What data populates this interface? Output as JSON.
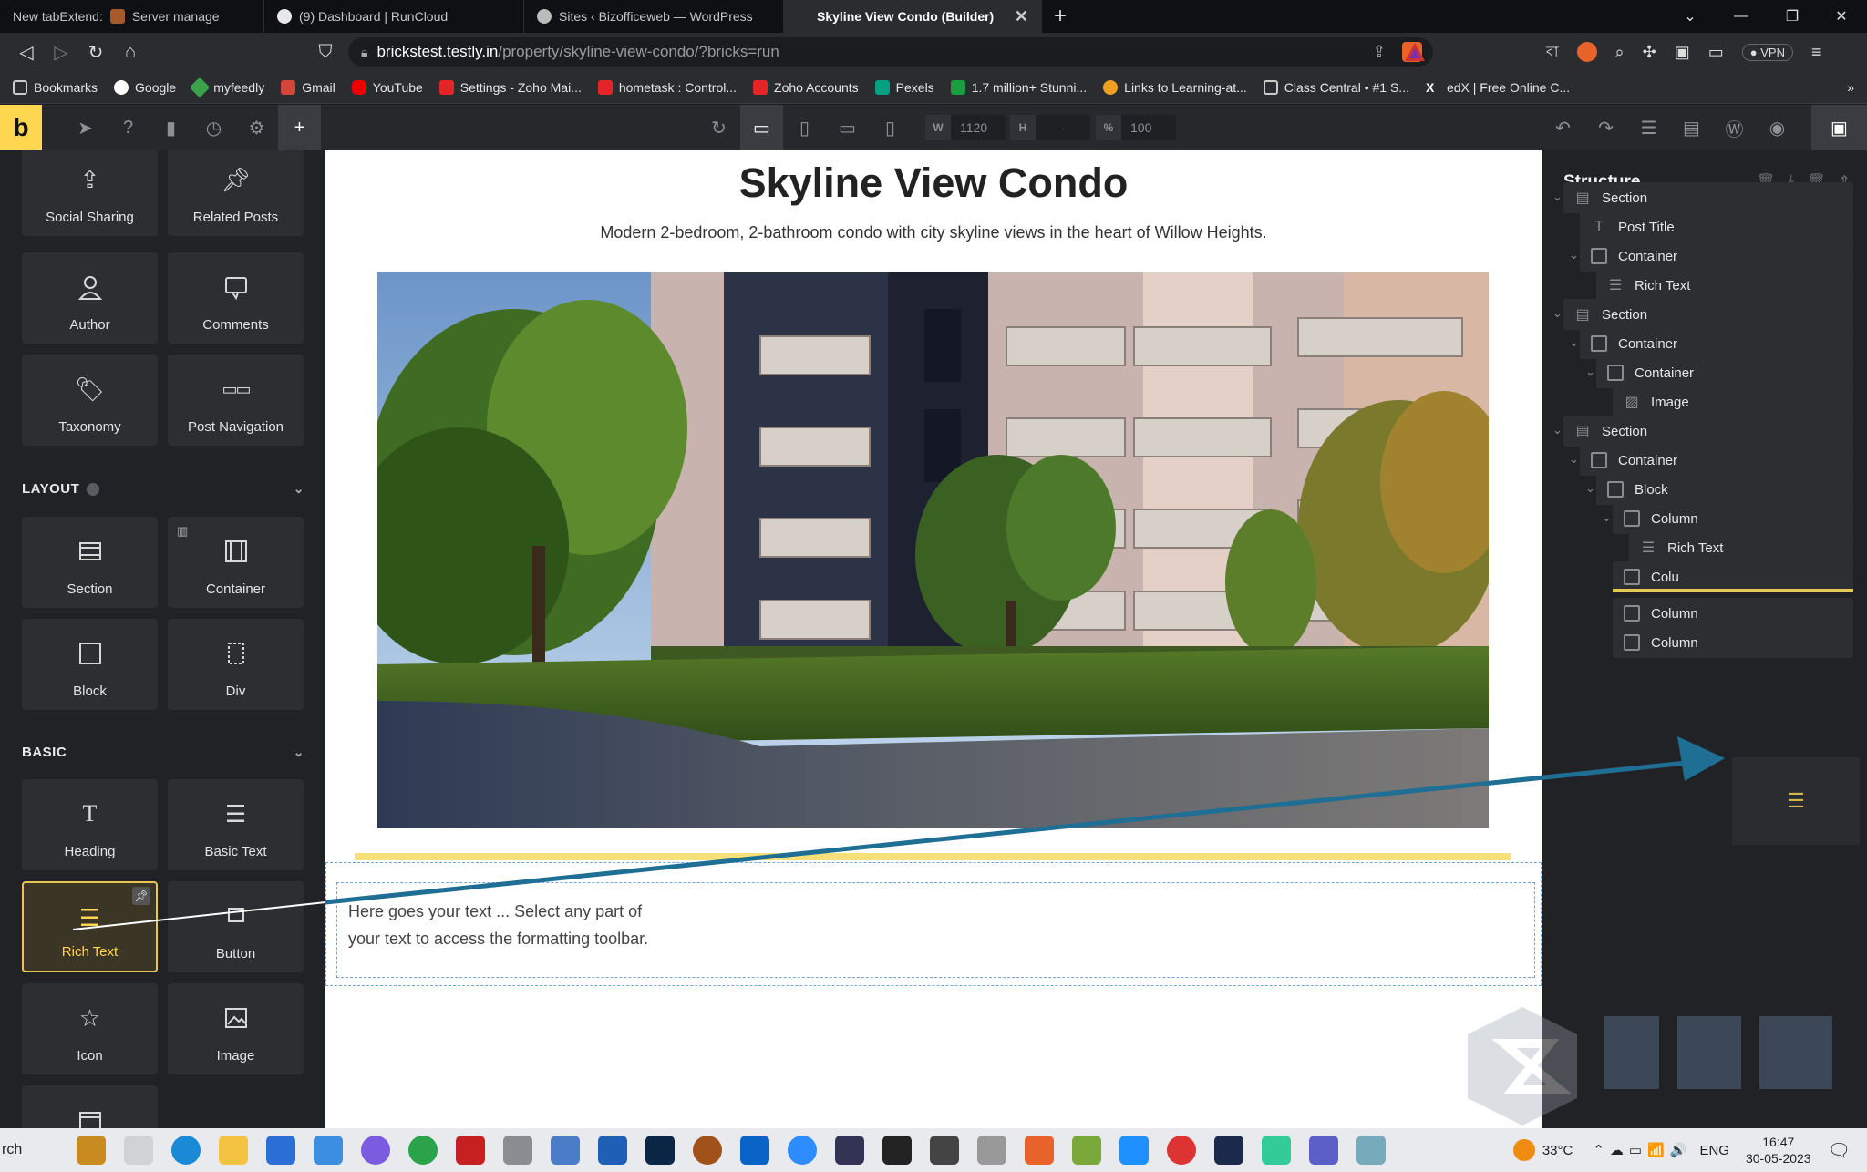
{
  "browser": {
    "tabs": [
      {
        "label": "New tabExtend:",
        "extra": "Server manage"
      },
      {
        "label": "(9) Dashboard | RunCloud"
      },
      {
        "label": "Sites ‹ Bizofficeweb — WordPress"
      },
      {
        "label": "Skyline View Condo (Builder)"
      }
    ],
    "url_host": "brickstest.testly.in",
    "url_path": "/property/skyline-view-condo/?bricks=run",
    "vpn_label": "VPN",
    "bookmarks": [
      "Bookmarks",
      "Google",
      "myfeedly",
      "Gmail",
      "YouTube",
      "Settings - Zoho Mai...",
      "hometask : Control...",
      "Zoho Accounts",
      "Pexels",
      "1.7 million+ Stunni...",
      "Links to Learning-at...",
      "Class Central • #1 S...",
      "edX | Free Online C..."
    ],
    "overflow": "»"
  },
  "builder": {
    "logo": "b",
    "width_label": "W",
    "width_value": "1120",
    "height_label": "H",
    "height_value": "-",
    "percent_label": "%",
    "percent_value": "100"
  },
  "left_panel": {
    "general_items": [
      "Social Sharing",
      "Related Posts",
      "Author",
      "Comments",
      "Taxonomy",
      "Post Navigation"
    ],
    "layout_heading": "LAYOUT",
    "layout_items": [
      "Section",
      "Container",
      "Block",
      "Div"
    ],
    "basic_heading": "BASIC",
    "basic_items": [
      "Heading",
      "Basic Text",
      "Rich Text",
      "Button",
      "Icon",
      "Image"
    ]
  },
  "canvas": {
    "title": "Skyline View Condo",
    "subtitle": "Modern 2-bedroom, 2-bathroom condo with city skyline views in the heart of Willow Heights.",
    "rich_text": "Here goes your text ... Select any part of your text to access the formatting toolbar."
  },
  "structure": {
    "title": "Structure",
    "rows": [
      {
        "label": "Section"
      },
      {
        "label": "Post Title"
      },
      {
        "label": "Container"
      },
      {
        "label": "Rich Text"
      },
      {
        "label": "Section"
      },
      {
        "label": "Container"
      },
      {
        "label": "Container"
      },
      {
        "label": "Image"
      },
      {
        "label": "Section"
      },
      {
        "label": "Container"
      },
      {
        "label": "Block"
      },
      {
        "label": "Column"
      },
      {
        "label": "Rich Text"
      },
      {
        "label": "Colu"
      },
      {
        "label": "Column"
      },
      {
        "label": "Column"
      }
    ]
  },
  "taskbar": {
    "search_fragment": "rch",
    "weather": "33°C",
    "language": "ENG",
    "time": "16:47",
    "date": "30-05-2023"
  },
  "colors": {
    "accent": "#ffd64f",
    "drop_line": "#e6c74f",
    "arrow": "#1f6e94"
  }
}
